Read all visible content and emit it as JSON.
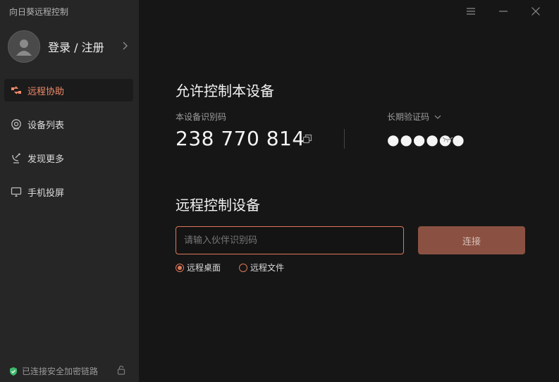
{
  "app": {
    "title": "向日葵远程控制"
  },
  "user": {
    "login_label": "登录 / 注册"
  },
  "nav": {
    "items": [
      {
        "label": "远程协助",
        "icon": "remote-assist-icon",
        "active": true
      },
      {
        "label": "设备列表",
        "icon": "device-list-icon",
        "active": false
      },
      {
        "label": "发现更多",
        "icon": "discover-icon",
        "active": false
      },
      {
        "label": "手机投屏",
        "icon": "screen-cast-icon",
        "active": false
      }
    ]
  },
  "status": {
    "text": "已连接安全加密链路"
  },
  "allow": {
    "title": "允许控制本设备",
    "device_id_label": "本设备识别码",
    "device_id": "238 770 814",
    "password_label": "长期验证码",
    "password_masked": "●●●●●●"
  },
  "remote": {
    "title": "远程控制设备",
    "input_placeholder": "请输入伙伴识别码",
    "connect_label": "连接",
    "options": [
      {
        "label": "远程桌面",
        "checked": true
      },
      {
        "label": "远程文件",
        "checked": false
      }
    ]
  },
  "colors": {
    "accent": "#e0785a",
    "sidebar_bg": "#262626",
    "main_bg": "#161616",
    "connect_btn": "#8a5142"
  }
}
